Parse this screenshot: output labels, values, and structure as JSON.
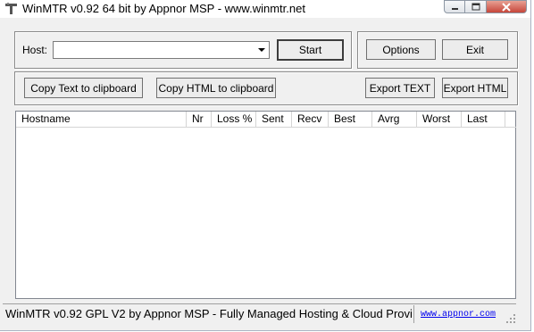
{
  "window": {
    "title": "WinMTR v0.92 64 bit by Appnor MSP - www.winmtr.net"
  },
  "host": {
    "label": "Host:",
    "value": ""
  },
  "buttons": {
    "start": "Start",
    "options": "Options",
    "exit": "Exit",
    "copy_text": "Copy Text to clipboard",
    "copy_html": "Copy HTML to clipboard",
    "export_text": "Export TEXT",
    "export_html": "Export HTML"
  },
  "table": {
    "columns": [
      "Hostname",
      "Nr",
      "Loss %",
      "Sent",
      "Recv",
      "Best",
      "Avrg",
      "Worst",
      "Last"
    ],
    "rows": []
  },
  "statusbar": {
    "text": "WinMTR v0.92 GPL V2 by Appnor MSP - Fully Managed Hosting & Cloud Provi",
    "link": "www.appnor.com"
  },
  "icons": {
    "app": "app-icon",
    "minimize": "minimize-icon",
    "maximize": "maximize-icon",
    "close": "close-icon",
    "dropdown": "chevron-down-icon",
    "grip": "resize-grip-icon"
  }
}
